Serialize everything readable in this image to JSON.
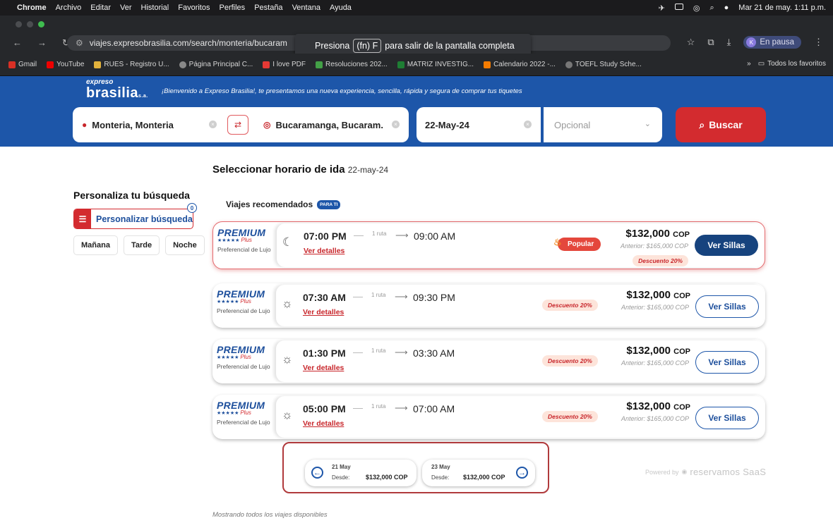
{
  "menubar": {
    "app": "Chrome",
    "items": [
      "Archivo",
      "Editar",
      "Ver",
      "Historial",
      "Favoritos",
      "Perfiles",
      "Pestaña",
      "Ventana",
      "Ayuda"
    ],
    "datetime": "Mar 21 de may.  1:11 p.m."
  },
  "browser": {
    "url": "viajes.expresobrasilia.com/search/monteria/bucaram",
    "fullscreen_notice": {
      "pre": "Presiona",
      "key": "(fn) F",
      "post": "para salir de la pantalla completa"
    },
    "profile_label": "En pausa",
    "profile_initial": "K",
    "bookmarks": [
      "Gmail",
      "YouTube",
      "RUES - Registro U...",
      "Página Principal C...",
      "I love PDF",
      "Resoluciones 202...",
      "MATRIZ INVESTIG...",
      "Calendario 2022 -...",
      "TOEFL Study Sche..."
    ],
    "all_favorites": "Todos los favoritos"
  },
  "header": {
    "logo_top": "expreso",
    "logo_main": "brasilia",
    "logo_suffix": "s.a.",
    "welcome": "¡Bienvenido a Expreso Brasilia!, te presentamos una nueva experiencia, sencilla, rápida y segura de comprar tus tiquetes",
    "origin": "Monteria, Monteria",
    "destination": "Bucaramanga, Bucaram.",
    "date": "22-May-24",
    "return_placeholder": "Opcional",
    "search_label": "Buscar"
  },
  "sidebar": {
    "title": "Personaliza tu búsqueda",
    "personalize_label": "Personalizar búsqueda",
    "filter_count": "0",
    "chips": [
      "Mañana",
      "Tarde",
      "Noche"
    ]
  },
  "main": {
    "title": "Seleccionar horario de ida",
    "date": "22-may-24",
    "recommended": "Viajes recomendados",
    "para_ti": "PARA TI",
    "trips": [
      {
        "brand": "PREMIUM",
        "plus": "Plus",
        "class": "Preferencial de Lujo",
        "icon": "moon-icon",
        "glyph": "☾",
        "depart": "07:00 PM",
        "route": "1 ruta",
        "arrive": "09:00 AM",
        "details": "Ver detalles",
        "price": "$132,000",
        "currency": "COP",
        "previous": "Anterior: $165,000 COP",
        "discount": "Descuento 20%",
        "badge": "Popular",
        "button": "Ver Sillas"
      },
      {
        "brand": "PREMIUM",
        "plus": "Plus",
        "class": "Preferencial de Lujo",
        "icon": "sunrise-icon",
        "glyph": "☼",
        "depart": "07:30 AM",
        "route": "1 ruta",
        "arrive": "09:30 PM",
        "details": "Ver detalles",
        "price": "$132,000",
        "currency": "COP",
        "previous": "Anterior: $165,000 COP",
        "discount": "Descuento 20%",
        "button": "Ver Sillas"
      },
      {
        "brand": "PREMIUM",
        "plus": "Plus",
        "class": "Preferencial de Lujo",
        "icon": "sun-icon",
        "glyph": "☼",
        "depart": "01:30 PM",
        "route": "1 ruta",
        "arrive": "03:30 AM",
        "details": "Ver detalles",
        "price": "$132,000",
        "currency": "COP",
        "previous": "Anterior: $165,000 COP",
        "discount": "Descuento 20%",
        "button": "Ver Sillas"
      },
      {
        "brand": "PREMIUM",
        "plus": "Plus",
        "class": "Preferencial de Lujo",
        "icon": "sun-icon",
        "glyph": "☼",
        "depart": "05:00 PM",
        "route": "1 ruta",
        "arrive": "07:00 AM",
        "details": "Ver detalles",
        "price": "$132,000",
        "currency": "COP",
        "previous": "Anterior: $165,000 COP",
        "discount": "Descuento 20%",
        "button": "Ver Sillas"
      }
    ],
    "prev_day": {
      "date": "21 May",
      "from": "Desde:",
      "price": "$132,000 COP"
    },
    "next_day": {
      "date": "23 May",
      "from": "Desde:",
      "price": "$132,000 COP"
    },
    "powered_by": "Powered by",
    "powered_brand": "reservamos SaaS",
    "footer": "Mostrando todos los viajes disponibles"
  },
  "colors": {
    "brand_blue": "#1d56a9",
    "brand_red": "#d32b2f",
    "discount_bg": "#fde4da"
  }
}
